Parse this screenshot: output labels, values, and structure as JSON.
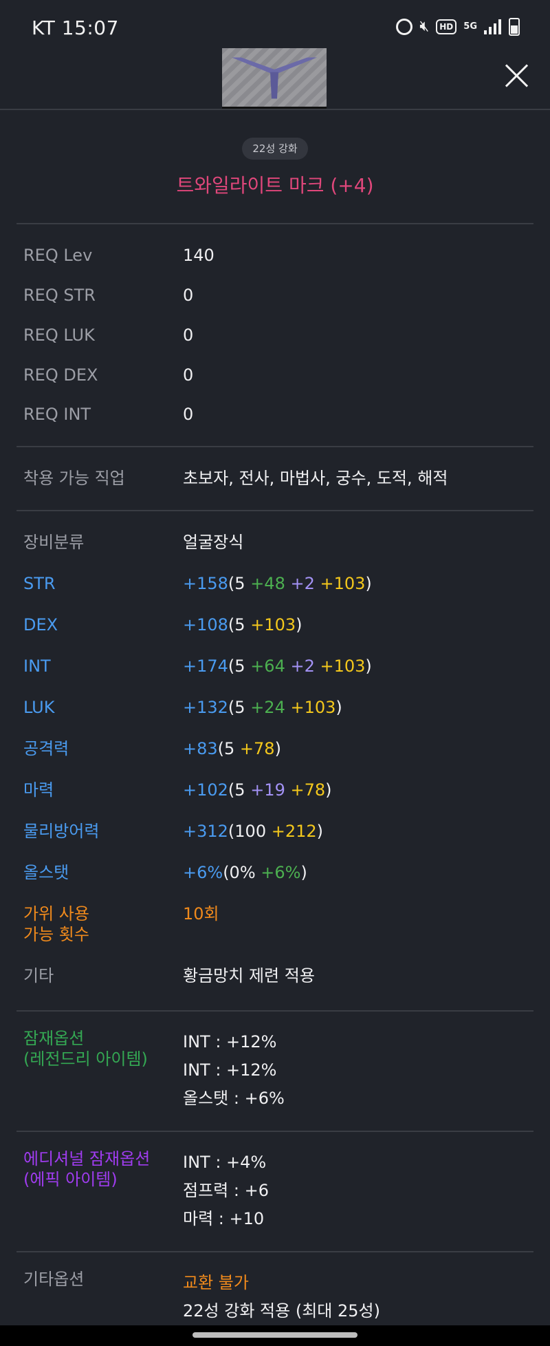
{
  "status_bar": {
    "time": "KT 15:07",
    "icons": [
      "alarm-icon",
      "mute-icon",
      "hd-icon",
      "5g-icon",
      "signal-icon",
      "battery-icon"
    ],
    "hd_label": "HD",
    "net_label": "5G"
  },
  "header": {
    "item_image": "twilight-mark-icon",
    "close_icon": "close-icon"
  },
  "item": {
    "star_badge": "22성 강화",
    "name": "트와일라이트 마크 (+4)",
    "name_color": "#e0477b"
  },
  "requirements": [
    {
      "label": "REQ Lev",
      "value": "140"
    },
    {
      "label": "REQ STR",
      "value": "0"
    },
    {
      "label": "REQ LUK",
      "value": "0"
    },
    {
      "label": "REQ DEX",
      "value": "0"
    },
    {
      "label": "REQ INT",
      "value": "0"
    }
  ],
  "jobs": {
    "label": "착용 가능 직업",
    "value": "초보자, 전사, 마법사, 궁수, 도적, 해적"
  },
  "category": {
    "label": "장비분류",
    "value": "얼굴장식"
  },
  "stats": [
    {
      "label": "STR",
      "total": "+158",
      "parts": [
        {
          "t": "(5",
          "c": "white"
        },
        {
          "t": " +48",
          "c": "green"
        },
        {
          "t": " +2",
          "c": "purple"
        },
        {
          "t": " +103",
          "c": "yellow"
        },
        {
          "t": ")",
          "c": "white"
        }
      ]
    },
    {
      "label": "DEX",
      "total": "+108",
      "parts": [
        {
          "t": "(5",
          "c": "white"
        },
        {
          "t": " +103",
          "c": "yellow"
        },
        {
          "t": ")",
          "c": "white"
        }
      ]
    },
    {
      "label": "INT",
      "total": "+174",
      "parts": [
        {
          "t": "(5",
          "c": "white"
        },
        {
          "t": " +64",
          "c": "green"
        },
        {
          "t": " +2",
          "c": "purple"
        },
        {
          "t": " +103",
          "c": "yellow"
        },
        {
          "t": ")",
          "c": "white"
        }
      ]
    },
    {
      "label": "LUK",
      "total": "+132",
      "parts": [
        {
          "t": "(5",
          "c": "white"
        },
        {
          "t": " +24",
          "c": "green"
        },
        {
          "t": " +103",
          "c": "yellow"
        },
        {
          "t": ")",
          "c": "white"
        }
      ]
    },
    {
      "label": "공격력",
      "total": "+83",
      "parts": [
        {
          "t": "(5",
          "c": "white"
        },
        {
          "t": " +78",
          "c": "yellow"
        },
        {
          "t": ")",
          "c": "white"
        }
      ]
    },
    {
      "label": "마력",
      "total": "+102",
      "parts": [
        {
          "t": "(5",
          "c": "white"
        },
        {
          "t": " +19",
          "c": "purple"
        },
        {
          "t": " +78",
          "c": "yellow"
        },
        {
          "t": ")",
          "c": "white"
        }
      ]
    },
    {
      "label": "물리방어력",
      "total": "+312",
      "parts": [
        {
          "t": "(100",
          "c": "white"
        },
        {
          "t": " +212",
          "c": "yellow"
        },
        {
          "t": ")",
          "c": "white"
        }
      ]
    },
    {
      "label": "올스탯",
      "total": "+6%",
      "parts": [
        {
          "t": "(0%",
          "c": "white"
        },
        {
          "t": " +6%",
          "c": "green"
        },
        {
          "t": ")",
          "c": "white"
        }
      ]
    }
  ],
  "scissors": {
    "label_line1": "가위 사용",
    "label_line2": "가능 횟수",
    "value": "10회"
  },
  "etc": {
    "label": "기타",
    "value": "황금망치 제련 적용"
  },
  "potential": {
    "label_line1": "잠재옵션",
    "label_line2": "(레전드리 아이템)",
    "lines": [
      "INT : +12%",
      "INT : +12%",
      "올스탯 : +6%"
    ]
  },
  "additional_potential": {
    "label_line1": "에디셔널 잠재옵션",
    "label_line2": "(에픽 아이템)",
    "lines": [
      "INT : +4%",
      "점프력 : +6",
      "마력 : +10"
    ]
  },
  "other_options": {
    "label": "기타옵션",
    "trade": "교환 불가",
    "star_note": "22성 강화 적용 (최대 25성)"
  },
  "colors": {
    "background": "#20232a",
    "stat_blue": "#4a9bf0",
    "green": "#4cb050",
    "purple": "#a392f5",
    "yellow": "#f4c81c",
    "orange": "#f08a1c",
    "item_name": "#e0477b"
  }
}
